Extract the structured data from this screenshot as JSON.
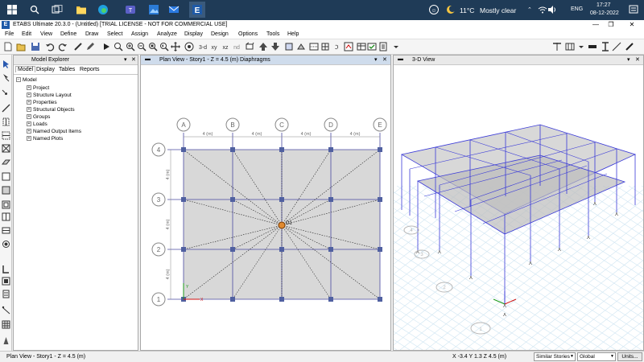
{
  "taskbar": {
    "icons": [
      "windows-start-icon",
      "search-icon",
      "task-view-icon",
      "file-explorer-icon",
      "edge-browser-icon",
      "teams-icon",
      "photos-icon",
      "mail-icon",
      "etabs-taskbar-icon"
    ],
    "weather": {
      "temperature": "11°C",
      "condition": "Mostly clear"
    },
    "language": "ENG",
    "time": "17:27",
    "date": "08-12-2022"
  },
  "window": {
    "title": "ETABS Ultimate 20.3.0 - (Untitled)  [TRIAL LICENSE - NOT FOR COMMERCIAL USE]",
    "logo": "E"
  },
  "menu": [
    "File",
    "Edit",
    "View",
    "Define",
    "Draw",
    "Select",
    "Assign",
    "Analyze",
    "Display",
    "Design",
    "Options",
    "Tools",
    "Help"
  ],
  "model_explorer": {
    "title": "Model Explorer",
    "tabs": [
      "Model",
      "Display",
      "Tables",
      "Reports"
    ],
    "active_tab": "Model",
    "root": "Model",
    "items": [
      "Project",
      "Structure Layout",
      "Properties",
      "Structural Objects",
      "Groups",
      "Loads",
      "Named Output Items",
      "Named Plots"
    ]
  },
  "plan_view": {
    "title": "Plan View - Story1 - Z = 4.5 (m)  Diaphragms",
    "grid_columns": [
      "A",
      "B",
      "C",
      "D",
      "E"
    ],
    "grid_rows": [
      "4",
      "3",
      "2",
      "1"
    ],
    "x_spacing_label": "4 (m)",
    "y_spacing_label": "4 (m)",
    "diaphragm_label": "D1",
    "axis_x": "X",
    "axis_y": "Y"
  },
  "view_3d": {
    "title": "3-D View",
    "grid_bubbles": [
      "4",
      "3",
      "2",
      "1"
    ]
  },
  "status": {
    "left": "Plan View - Story1 - Z = 4.5 (m)",
    "coords": "X -3.4  Y 1.3  Z 4.5 (m)",
    "stories_option": "Similar Stories",
    "coord_system": "Global",
    "units_button": "Units..."
  },
  "colors": {
    "taskbar": "#1f3b57",
    "grid_line": "#4a4aa0",
    "joint": "#5060a0",
    "frame_3d": "#3a3ad8",
    "slab_fill": "#d8d8d8",
    "active_view_header": "#cfdcec"
  }
}
